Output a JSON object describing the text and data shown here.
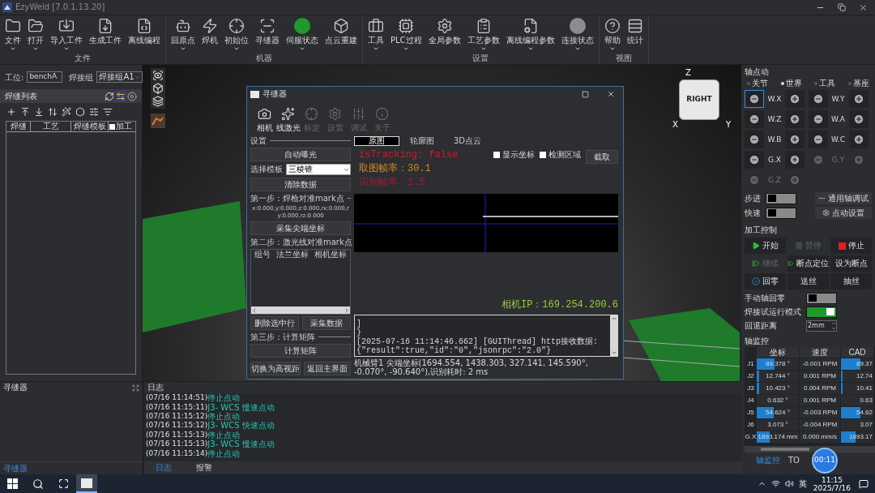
{
  "window": {
    "title": "EzyWeld  [7.0.1.13.20]"
  },
  "ribbon": {
    "groups": [
      {
        "label": "文件",
        "items": [
          {
            "label": "文件",
            "kind": "folder",
            "dropdown": true
          },
          {
            "label": "打开",
            "kind": "open",
            "dropdown": true
          },
          {
            "label": "导入工件",
            "kind": "import",
            "dropdown": true
          },
          {
            "label": "生成工件",
            "kind": "generate",
            "dropdown": false
          },
          {
            "label": "离线编程",
            "kind": "program",
            "dropdown": false
          }
        ]
      },
      {
        "label": "机器",
        "items": [
          {
            "label": "回原点",
            "kind": "robot",
            "dropdown": true
          },
          {
            "label": "焊机",
            "kind": "welder",
            "dropdown": false
          },
          {
            "label": "初始位",
            "kind": "target",
            "dropdown": true
          },
          {
            "label": "寻缝器",
            "kind": "scanner",
            "dropdown": false
          },
          {
            "label": "伺服状态",
            "kind": "status",
            "dropdown": true,
            "color": "#1f9a2e"
          },
          {
            "label": "点云重建",
            "kind": "cloud",
            "dropdown": false
          }
        ]
      },
      {
        "label": "设置",
        "items": [
          {
            "label": "工具",
            "kind": "tool",
            "dropdown": true
          },
          {
            "label": "PLC过程",
            "kind": "plc",
            "dropdown": true
          },
          {
            "label": "全局参数",
            "kind": "gear",
            "dropdown": false
          },
          {
            "label": "工艺参数",
            "kind": "process",
            "dropdown": true
          },
          {
            "label": "离线编程参数",
            "kind": "offline",
            "dropdown": true
          },
          {
            "label": "连接状态",
            "kind": "status",
            "dropdown": true,
            "color": "#8c8c8c"
          }
        ]
      },
      {
        "label": "视图",
        "items": [
          {
            "label": "帮助",
            "kind": "help",
            "dropdown": true
          },
          {
            "label": "统计",
            "kind": "stats",
            "dropdown": false
          }
        ]
      }
    ]
  },
  "left_panel": {
    "station": {
      "label": "工位:",
      "value": "benchA"
    },
    "group": {
      "label": "焊接组",
      "value": "焊接组A1"
    },
    "title": "焊缝列表",
    "columns": [
      "焊缝",
      "工艺",
      "焊缝模板"
    ],
    "process_column": {
      "label": "加工",
      "checked": false
    }
  },
  "viewport": {
    "view_cube": "RIGHT",
    "axes": [
      "Z",
      "X",
      "Y"
    ]
  },
  "seam_finder": {
    "title": "寻缝器",
    "tools": [
      {
        "label": "相机",
        "kind": "camera",
        "disabled": false
      },
      {
        "label": "线激光",
        "kind": "laser",
        "disabled": false
      },
      {
        "label": "标定",
        "kind": "target",
        "disabled": true
      },
      {
        "label": "设置",
        "kind": "gear",
        "disabled": true
      },
      {
        "label": "调试",
        "kind": "sliders",
        "disabled": true
      },
      {
        "label": "关于",
        "kind": "info",
        "disabled": true
      }
    ],
    "settings": {
      "title": "设置",
      "auto_exposure": "自动曝光",
      "template_label": "选择模板",
      "template": "三棱锥",
      "clear": "清除数据"
    },
    "step1": {
      "title": "第一步：焊枪对准mark点",
      "coords": "x:0.000,y:0.000,z:0.000,rx:0.000,ry:0.000,rz:0.000",
      "button": "采集尖端坐标"
    },
    "step2": {
      "title": "第二步：激光线对准mark点",
      "columns": [
        "组号",
        "法兰坐标",
        "相机坐标"
      ],
      "buttons": [
        "删除选中行",
        "采集数据"
      ]
    },
    "step3": {
      "title": "第三步：计算矩阵",
      "button": "计算矩阵"
    },
    "footer_buttons": [
      "切换为高视距",
      "返回主界面"
    ],
    "view_tabs": [
      {
        "label": "原图",
        "selected": true
      },
      {
        "label": "轮廓图",
        "selected": false
      },
      {
        "label": "3D点云",
        "selected": false
      }
    ],
    "overlay": [
      {
        "text": "isTracking: false",
        "color": "#c4202c"
      },
      {
        "text": "取图帧率：30.1",
        "color": "#d08a1c"
      },
      {
        "text": "识别帧率：1.5",
        "color": "#a8182e"
      }
    ],
    "options": [
      {
        "label": "显示坐标",
        "checked": false
      },
      {
        "label": "检测区域",
        "checked": false
      }
    ],
    "capture_button": "截取",
    "camera_ip": "相机IP：169.254.200.6",
    "console": [
      "]",
      "}",
      "[2025-07-16 11:14:46.662] [GUIThread] http接收数据: {\"result\":true,\"id\":\"0\",\"jsonrpc\":\"2.0\"}"
    ],
    "status": "机械臂1 尖端坐标(1694.554, 1438.303, 327.141, 145.590°, -0.070°, -90.640°),识别耗时: 2 ms"
  },
  "finder_panel": {
    "title": "寻缝器",
    "tab": "寻缝器"
  },
  "log": {
    "title": "日志",
    "entries": [
      {
        "time": "(07/16 11:14:51)",
        "message": "停止点动"
      },
      {
        "time": "(07/16 11:15:11)",
        "message": "J3- WCS 慢速点动"
      },
      {
        "time": "(07/16 11:15:12)",
        "message": "停止点动"
      },
      {
        "time": "(07/16 11:15:12)",
        "message": "J3- WCS 快速点动"
      },
      {
        "time": "(07/16 11:15:13)",
        "message": "停止点动"
      },
      {
        "time": "(07/16 11:15:13)",
        "message": "J3- WCS 慢速点动"
      },
      {
        "time": "(07/16 11:15:14)",
        "message": "停止点动"
      }
    ],
    "tabs": [
      {
        "label": "日志",
        "selected": true
      },
      {
        "label": "报警",
        "selected": false
      }
    ]
  },
  "jog": {
    "title": "轴点动",
    "frames": [
      {
        "label": "关节",
        "selected": false
      },
      {
        "label": "世界",
        "selected": true
      },
      {
        "label": "工具",
        "selected": false
      },
      {
        "label": "基座",
        "selected": false
      }
    ],
    "axes": [
      {
        "label": "W.X",
        "disabled": false
      },
      {
        "label": "W.Y",
        "disabled": false
      },
      {
        "label": "W.Z",
        "disabled": false
      },
      {
        "label": "W.A",
        "disabled": false
      },
      {
        "label": "W.B",
        "disabled": false
      },
      {
        "label": "W.C",
        "disabled": false
      },
      {
        "label": "G.X",
        "disabled": false
      },
      {
        "label": "G.Y",
        "disabled": true
      },
      {
        "label": "G.Z",
        "disabled": true
      }
    ],
    "switches": [
      {
        "label": "步进",
        "on": false
      },
      {
        "label": "快速",
        "on": false
      }
    ],
    "buttons": [
      {
        "label": "通用轴调试",
        "kind": "more"
      },
      {
        "label": "点动设置",
        "kind": "gear"
      }
    ]
  },
  "process": {
    "title": "加工控制",
    "buttons": [
      {
        "label": "开始",
        "kind": "play",
        "disabled": false
      },
      {
        "label": "暂停",
        "kind": "pause",
        "disabled": true
      },
      {
        "label": "停止",
        "kind": "stop",
        "disabled": false
      },
      {
        "label": "继续",
        "kind": "resume",
        "disabled": true
      },
      {
        "label": "断点定位",
        "kind": "resume",
        "disabled": false
      },
      {
        "label": "设为断点",
        "kind": "plain",
        "disabled": false
      },
      {
        "label": "回零",
        "kind": "home",
        "disabled": false
      },
      {
        "label": "送丝",
        "kind": "plain",
        "disabled": false
      },
      {
        "label": "抽丝",
        "kind": "plain",
        "disabled": false
      }
    ],
    "settings": [
      {
        "label": "手动轴回零",
        "kind": "toggle",
        "on": false
      },
      {
        "label": "焊接试运行模式",
        "kind": "toggle",
        "on": true
      },
      {
        "label": "回退距离",
        "kind": "spin",
        "value": "2mm"
      }
    ]
  },
  "monitor": {
    "title": "轴监控",
    "columns": [
      "坐标",
      "速度",
      "CAD"
    ],
    "rows": [
      {
        "axis": "J1",
        "position": {
          "value": "89.378 °",
          "level": 0.42
        },
        "speed": "-0.001 RPM",
        "cad": {
          "value": "89.37",
          "level": 0.6
        }
      },
      {
        "axis": "J2",
        "position": {
          "value": "12.744 °",
          "level": 0.05
        },
        "speed": "0.001 RPM",
        "cad": {
          "value": "12.74",
          "level": 0.06
        }
      },
      {
        "axis": "J3",
        "position": {
          "value": "10.423 °",
          "level": 0.05
        },
        "speed": "0.004 RPM",
        "cad": {
          "value": "10.41",
          "level": 0.06
        }
      },
      {
        "axis": "J4",
        "position": {
          "value": "0.632 °",
          "level": 0
        },
        "speed": "0.001 RPM",
        "cad": {
          "value": "0.63",
          "level": 0
        }
      },
      {
        "axis": "J5",
        "position": {
          "value": "54.624 °",
          "level": 0.4
        },
        "speed": "-0.003 RPM",
        "cad": {
          "value": "54.62",
          "level": 0.6
        }
      },
      {
        "axis": "J6",
        "position": {
          "value": "3.073 °",
          "level": 0
        },
        "speed": "-0.004 RPM",
        "cad": {
          "value": "3.07",
          "level": 0
        }
      },
      {
        "axis": "G.X",
        "position": {
          "value": "1893.174 mm",
          "level": 0.3
        },
        "speed": "0.000 mm/s",
        "cad": {
          "value": "1893.17",
          "level": 0.45
        }
      }
    ],
    "tabs": [
      {
        "label": "轴监控",
        "selected": true
      },
      {
        "label": "TO",
        "selected": false
      }
    ]
  },
  "recorder": {
    "time": "00:11"
  },
  "taskbar": {
    "ime": "英",
    "time": "11:15",
    "date": "2025/7/16"
  }
}
